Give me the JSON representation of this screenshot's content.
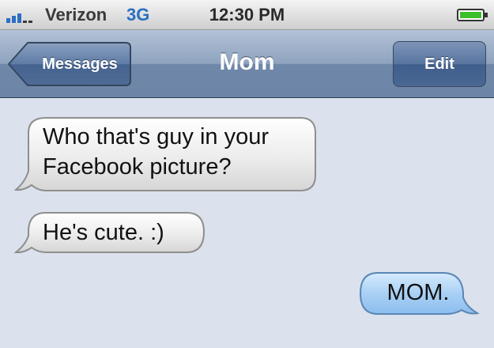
{
  "status_bar": {
    "carrier": "Verizon",
    "network": "3G",
    "time": "12:30 PM",
    "signal_icon": "signal-bars-icon",
    "battery_icon": "battery-icon",
    "battery_color": "#3bbf2b",
    "network_color": "#2a6fc0"
  },
  "nav": {
    "back_label": "Messages",
    "title": "Mom",
    "edit_label": "Edit"
  },
  "messages": [
    {
      "sender": "contact",
      "text": "Who that's guy in your\nFacebook picture?"
    },
    {
      "sender": "contact",
      "text": "He's cute. :)"
    },
    {
      "sender": "me",
      "text": "MOM."
    }
  ],
  "colors": {
    "background": "#dbe2ed",
    "incoming_bubble": "#e9e9e9",
    "outgoing_bubble": "#a9d0f5"
  }
}
